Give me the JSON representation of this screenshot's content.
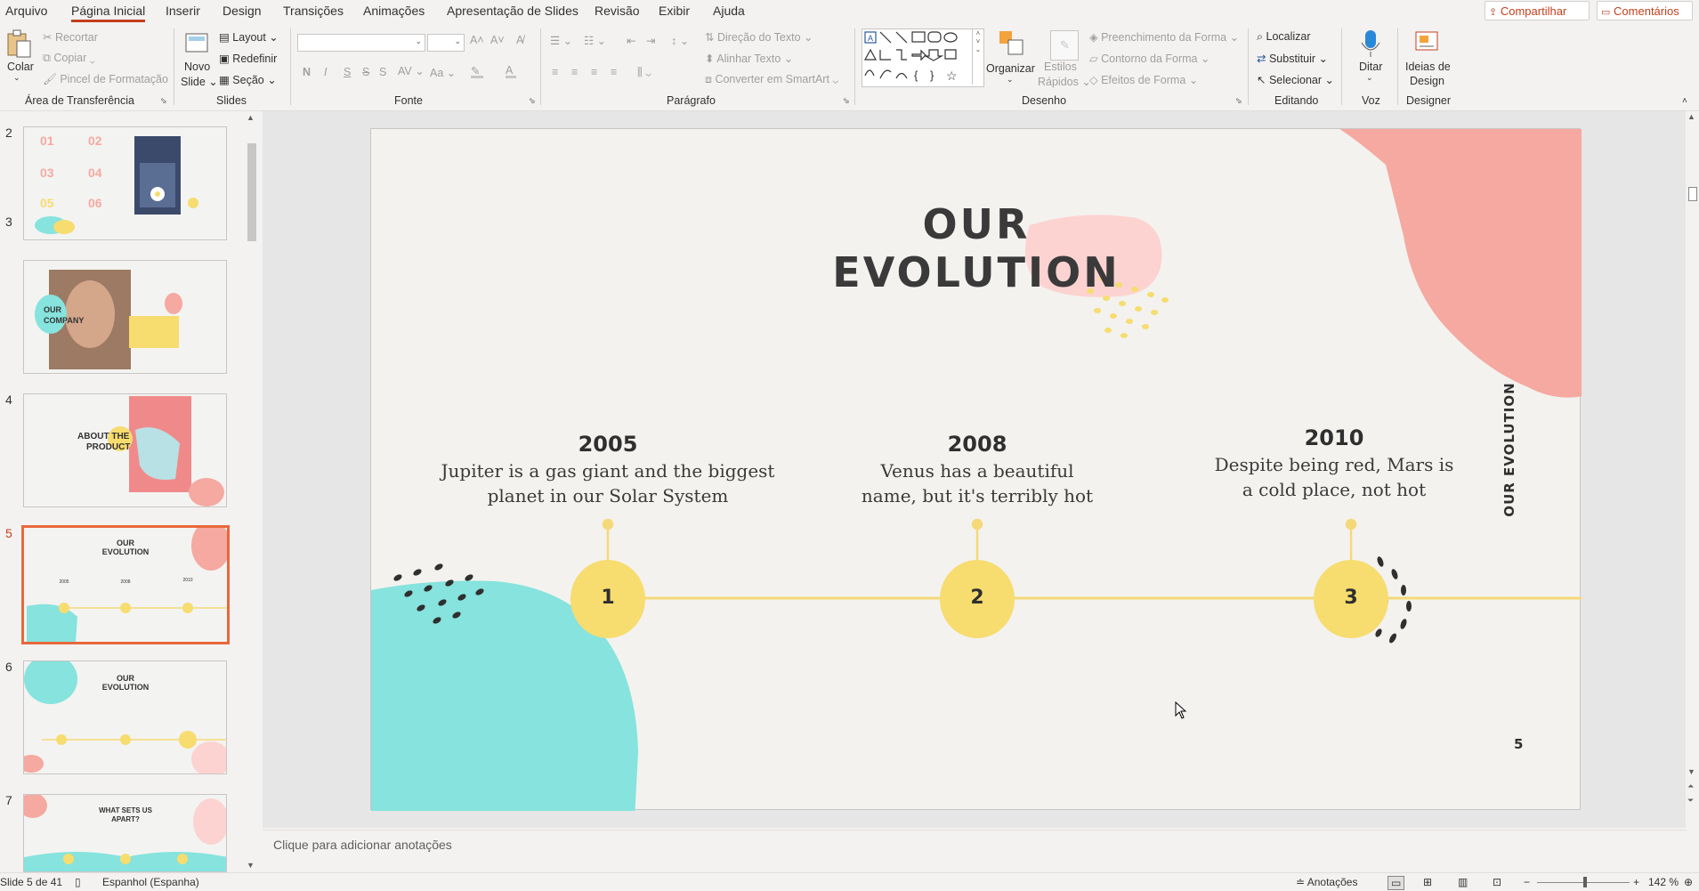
{
  "menu": {
    "items": [
      "Arquivo",
      "Página Inicial",
      "Inserir",
      "Design",
      "Transições",
      "Animações",
      "Apresentação de Slides",
      "Revisão",
      "Exibir",
      "Ajuda"
    ],
    "share": "Compartilhar",
    "comments": "Comentários"
  },
  "ribbon": {
    "clipboard": {
      "paste": "Colar",
      "cut": "Recortar",
      "copy": "Copiar",
      "format_painter": "Pincel de Formatação",
      "label": "Área de Transferência"
    },
    "slides": {
      "new_slide_1": "Novo",
      "new_slide_2": "Slide",
      "layout": "Layout",
      "reset": "Redefinir",
      "section": "Seção",
      "label": "Slides"
    },
    "font": {
      "label": "Fonte",
      "bold": "N",
      "italic": "I",
      "underline": "S",
      "strike": "S",
      "spacing": "AV",
      "case": "Aa"
    },
    "paragraph": {
      "text_direction": "Direção do Texto",
      "align_text": "Alinhar Texto",
      "smartart": "Converter em SmartArt",
      "label": "Parágrafo"
    },
    "drawing": {
      "arrange": "Organizar",
      "quick_styles_1": "Estilos",
      "quick_styles_2": "Rápidos",
      "shape_fill": "Preenchimento da Forma",
      "shape_outline": "Contorno da Forma",
      "shape_effects": "Efeitos de Forma",
      "label": "Desenho"
    },
    "editing": {
      "find": "Localizar",
      "replace": "Substituir",
      "select": "Selecionar",
      "label": "Editando"
    },
    "voice": {
      "dictate": "Ditar",
      "label": "Voz"
    },
    "designer": {
      "ideas_1": "Ideias de",
      "ideas_2": "Design",
      "label": "Designer"
    }
  },
  "thumbnails": [
    {
      "num": "2",
      "title": ""
    },
    {
      "num": "3",
      "title": "OUR COMPANY"
    },
    {
      "num": "4",
      "title": "ABOUT THE PRODUCT"
    },
    {
      "num": "5",
      "title": "OUR EVOLUTION",
      "selected": true
    },
    {
      "num": "6",
      "title": "OUR EVOLUTION"
    },
    {
      "num": "7",
      "title": "WHAT SETS US APART?"
    }
  ],
  "slide": {
    "title_line1": "OUR",
    "title_line2": "EVOLUTION",
    "side_label": "OUR EVOLUTION",
    "page_number": "5",
    "milestones": [
      {
        "year": "2005",
        "text_line1": "Jupiter is a gas giant and the biggest",
        "text_line2": "planet in our Solar System",
        "number": "1"
      },
      {
        "year": "2008",
        "text_line1": "Venus has a beautiful",
        "text_line2": "name, but it's terribly hot",
        "number": "2"
      },
      {
        "year": "2010",
        "text_line1": "Despite being red, Mars is",
        "text_line2": "a cold place, not hot",
        "number": "3"
      }
    ],
    "colors": {
      "pink": "#f5a9a0",
      "teal": "#86e3dd",
      "yellow": "#f7dc6f",
      "line": "#f5d978",
      "dark": "#2f2f2f"
    }
  },
  "notes": {
    "placeholder": "Clique para adicionar anotações"
  },
  "status": {
    "slide_info": "Slide 5 de 41",
    "language": "Espanhol (Espanha)",
    "notes": "Anotações",
    "zoom": "142 %"
  }
}
